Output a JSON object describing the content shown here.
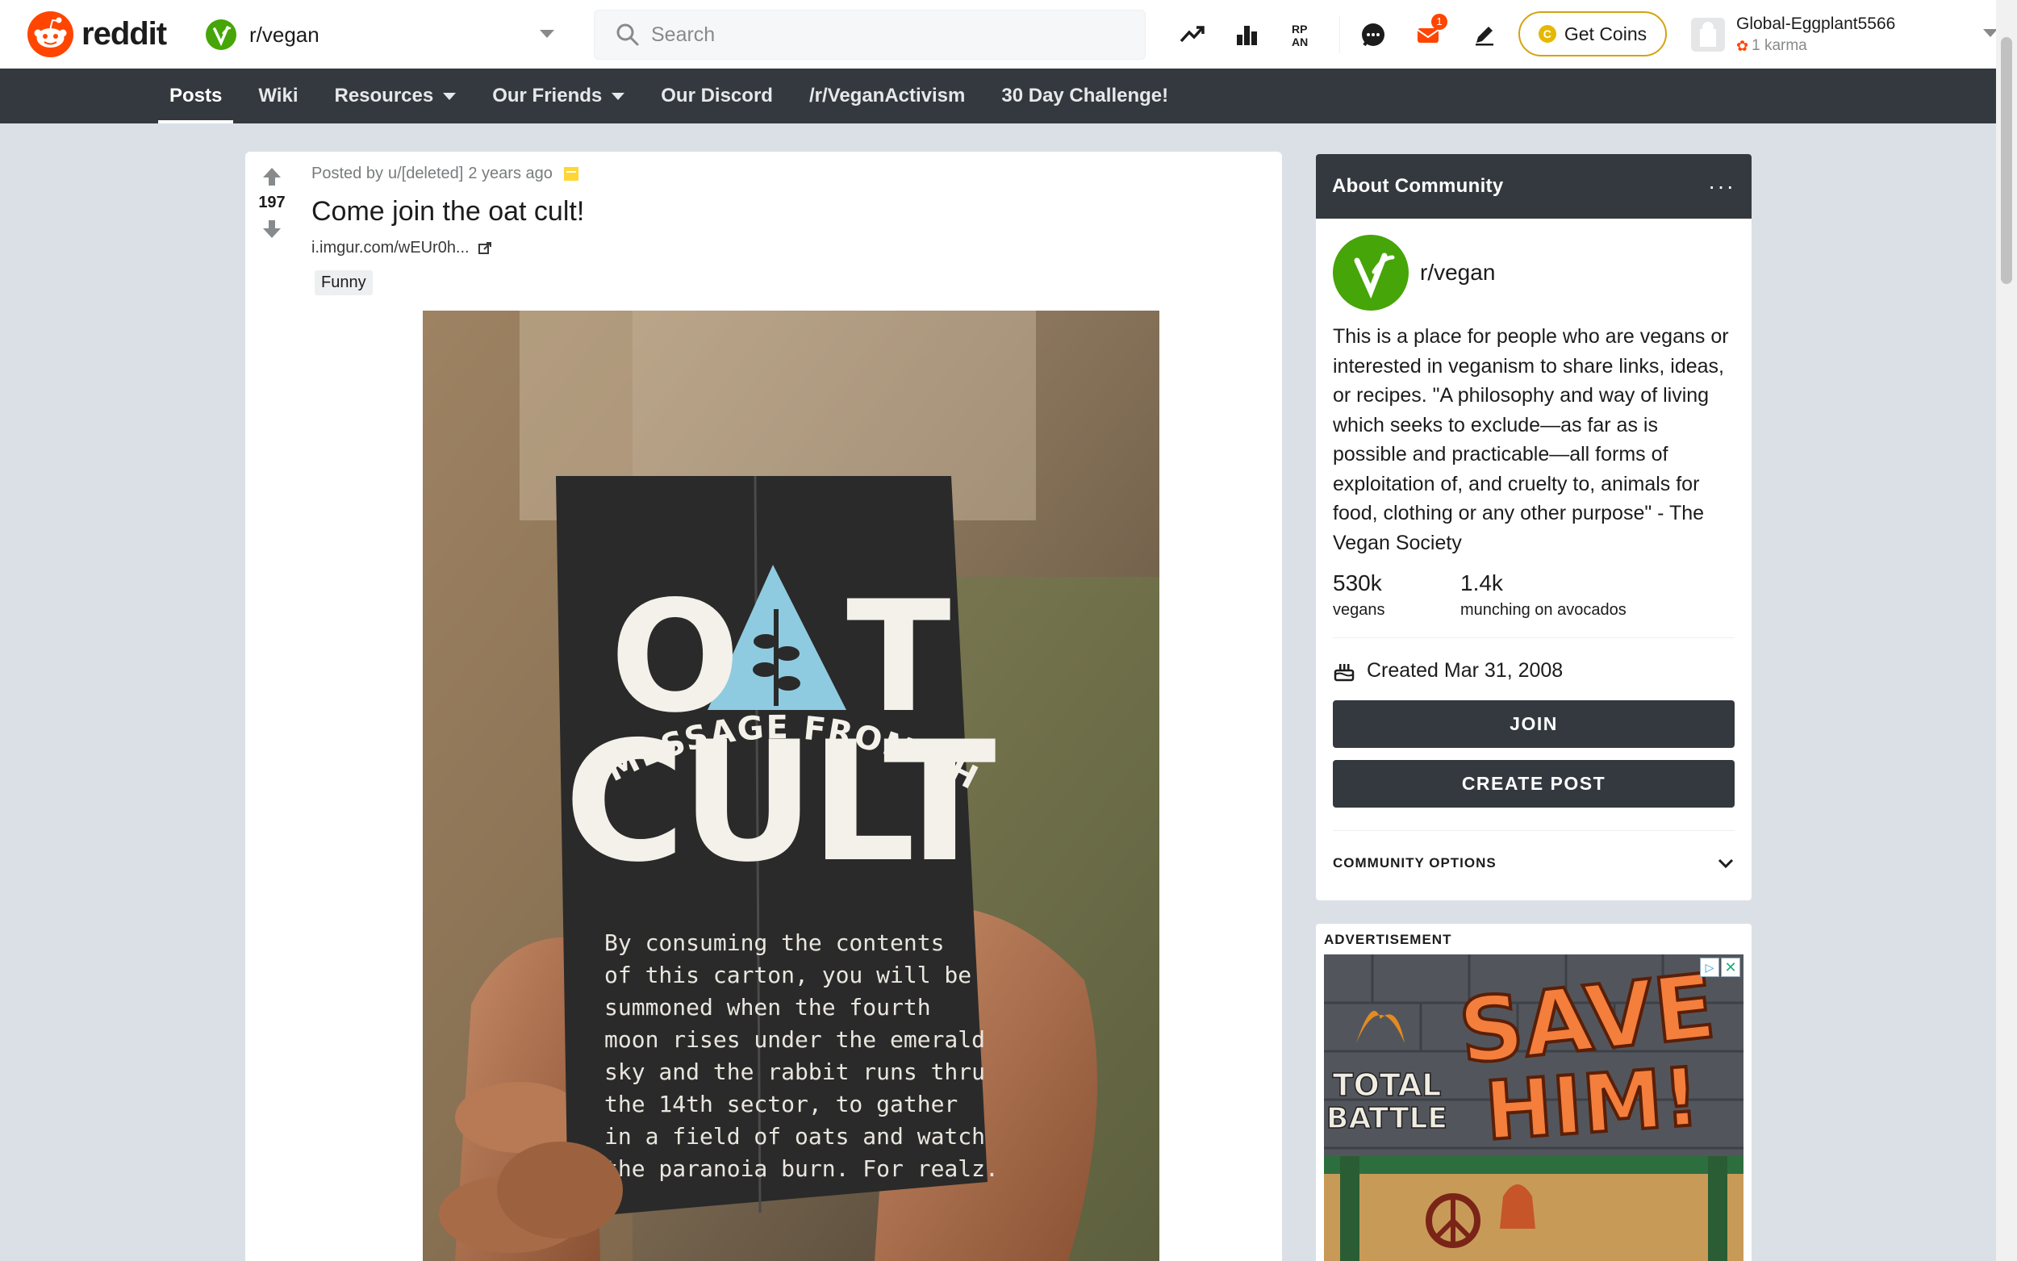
{
  "header": {
    "logo_text": "reddit",
    "community": "r/vegan",
    "search_placeholder": "Search",
    "mail_badge": "1",
    "coins_label": "Get Coins",
    "coin_glyph": "C",
    "username": "Global-Eggplant5566",
    "karma": "1 karma",
    "icons": [
      "popular-icon",
      "leaderboard-icon",
      "community-icon",
      "chat-icon",
      "mail-icon",
      "edit-icon"
    ]
  },
  "nav": {
    "items": [
      {
        "label": "Posts",
        "active": true
      },
      {
        "label": "Wiki"
      },
      {
        "label": "Resources",
        "dropdown": true
      },
      {
        "label": "Our Friends",
        "dropdown": true
      },
      {
        "label": "Our Discord"
      },
      {
        "label": "/r/VeganActivism"
      },
      {
        "label": "30 Day Challenge!"
      }
    ]
  },
  "post": {
    "votes": "197",
    "meta_prefix": "Posted by",
    "author": "u/[deleted]",
    "age": "2 years ago",
    "title": "Come join the oat cult!",
    "link": "i.imgur.com/wEUr0h...",
    "flair": "Funny",
    "image_text": {
      "arc": "A MESSAGE FROM THE",
      "brand_left": "O",
      "brand_right": "T",
      "brand_bottom": "CULT",
      "body_lines": [
        "By consuming the contents",
        "of this carton, you will be",
        "summoned when the fourth",
        "moon rises under the emerald",
        "sky and the rabbit runs thru",
        "the 14th sector, to gather",
        "in a field of oats and watch",
        "the paranoia burn. For realz."
      ]
    }
  },
  "about": {
    "title": "About Community",
    "name": "r/vegan",
    "description": "This is a place for people who are vegans or interested in veganism to share links, ideas, or recipes. \"A philosophy and way of living which seeks to exclude—as far as is possible and practicable—all forms of exploitation of, and cruelty to, animals for food, clothing or any other purpose\" - The Vegan Society",
    "members_count": "530k",
    "members_label": "vegans",
    "online_count": "1.4k",
    "online_label": "munching on avocados",
    "created": "Created Mar 31, 2008",
    "join_label": "JOIN",
    "create_post_label": "CREATE POST",
    "options_label": "COMMUNITY OPTIONS"
  },
  "ad": {
    "label": "ADVERTISEMENT",
    "game_name_1": "TOTAL",
    "game_name_2": "BATTLE",
    "headline_1": "SAVE",
    "headline_2": "HIM!"
  },
  "colors": {
    "brand": "#ff4500",
    "community": "#46a508",
    "banner": "#33393e",
    "background": "#dae0e6"
  }
}
